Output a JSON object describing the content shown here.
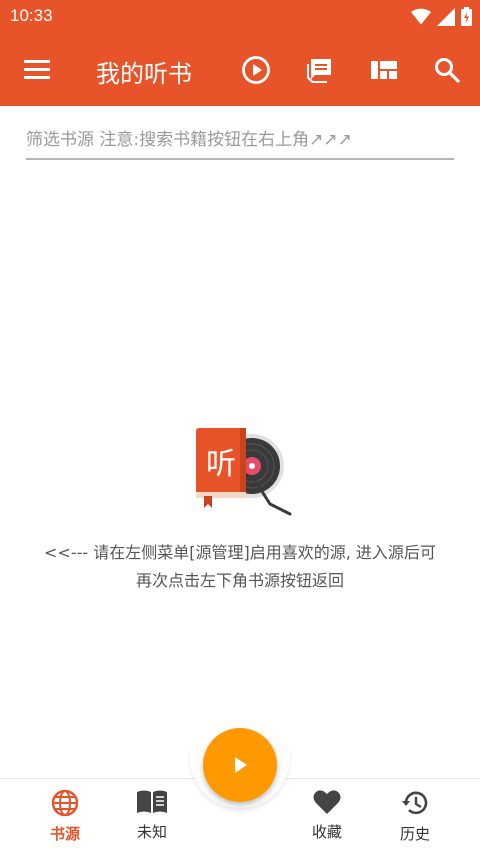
{
  "status_bar": {
    "time": "10:33",
    "icons": [
      "wifi-icon",
      "signal-icon",
      "battery-icon"
    ]
  },
  "app_bar": {
    "title": "我的听书",
    "actions": [
      "play-circle-icon",
      "chat-icon",
      "view-dashboard-icon",
      "search-icon"
    ],
    "color": "#e8542a"
  },
  "filter": {
    "placeholder": "筛选书源 注意:搜索书籍按钮在右上角↗↗↗"
  },
  "empty_state": {
    "badge_text": "听",
    "message_line1": "<<--- 请在左侧菜单[源管理]启用喜欢的源, 进入源后可",
    "message_line2": "再次点击左下角书源按钮返回"
  },
  "bottom_nav": {
    "items": [
      {
        "label": "书源",
        "icon": "globe-icon",
        "active": true
      },
      {
        "label": "未知",
        "icon": "book-open-icon",
        "active": false
      },
      {
        "label": "收藏",
        "icon": "heart-icon",
        "active": false
      },
      {
        "label": "历史",
        "icon": "history-icon",
        "active": false
      }
    ],
    "fab_icon": "play-icon",
    "fab_color": "#ff9900",
    "active_color": "#e8542a"
  }
}
